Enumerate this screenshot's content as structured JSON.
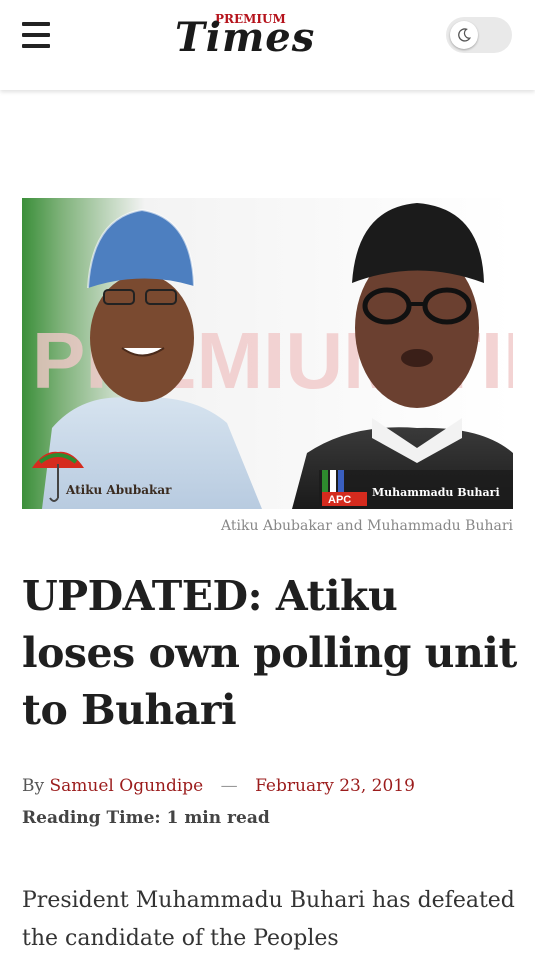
{
  "header": {
    "logo_top": "PREMIUM",
    "logo_main": "Times",
    "menu_icon": "hamburger-menu-icon",
    "theme_toggle_icon": "moon-icon",
    "dark_mode": false
  },
  "hero": {
    "watermark": "PREMIUM TIMES",
    "left_label": "Atiku Abubakar",
    "right_party": "APC",
    "right_label": "Muhammadu Buhari",
    "caption": "Atiku Abubakar and Muhammadu Buhari"
  },
  "article": {
    "headline": "UPDATED: Atiku loses own polling unit to Buhari",
    "by_prefix": "By",
    "author": "Samuel Ogundipe",
    "separator": "—",
    "date": "February 23, 2019",
    "reading_time": "Reading Time: 1 min read",
    "body": "President Muhammadu Buhari has defeated the candidate of the Peoples"
  },
  "colors": {
    "accent": "#9b1c1c",
    "logo_red": "#b5121b"
  }
}
